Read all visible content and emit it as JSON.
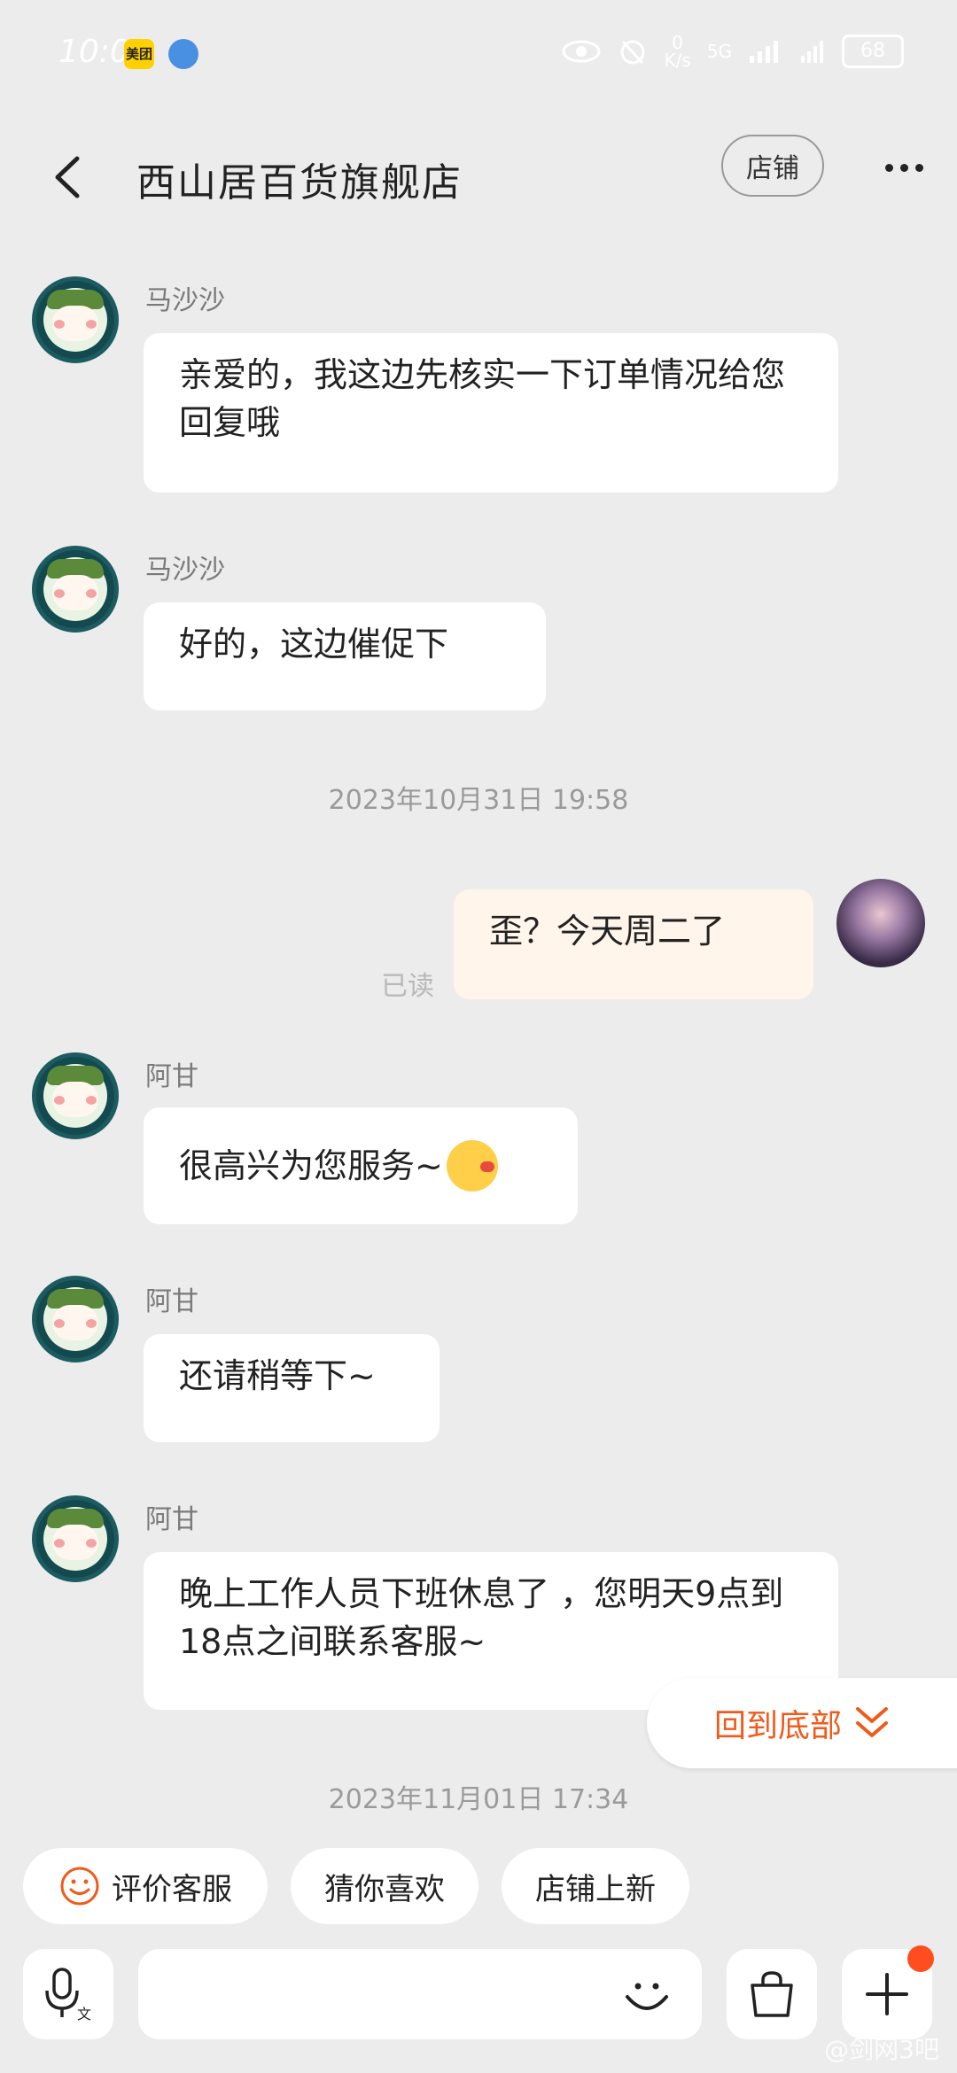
{
  "status_bar": {
    "time": "10:06",
    "badge_meituan": "美团",
    "net_speed_top": "0",
    "net_speed_unit": "K/s",
    "network": "5G",
    "battery": "68"
  },
  "header": {
    "title": "西山居百货旗舰店",
    "shop_label": "店铺"
  },
  "messages": [
    {
      "sender": "马沙沙",
      "text": "亲爱的，我这边先核实一下订单情况给您回复哦"
    },
    {
      "sender": "马沙沙",
      "text": "好的，这边催促下"
    },
    {
      "timestamp": "2023年10月31日  19:58"
    },
    {
      "self_text": "歪？今天周二了",
      "read": "已读"
    },
    {
      "sender": "阿甘",
      "text": "很高兴为您服务~"
    },
    {
      "sender": "阿甘",
      "text": "还请稍等下~"
    },
    {
      "sender": "阿甘",
      "text": "晚上工作人员下班休息了 ，您明天9点到18点之间联系客服~"
    },
    {
      "timestamp": "2023年11月01日  17:34"
    }
  ],
  "back_to_bottom": "回到底部",
  "chips": {
    "rate": "评价客服",
    "guess": "猜你喜欢",
    "new": "店铺上新"
  },
  "watermark": "@剑网3吧",
  "colors": {
    "accent": "#f05a1a",
    "background": "#ececec",
    "self_bubble": "#fff5ea"
  }
}
